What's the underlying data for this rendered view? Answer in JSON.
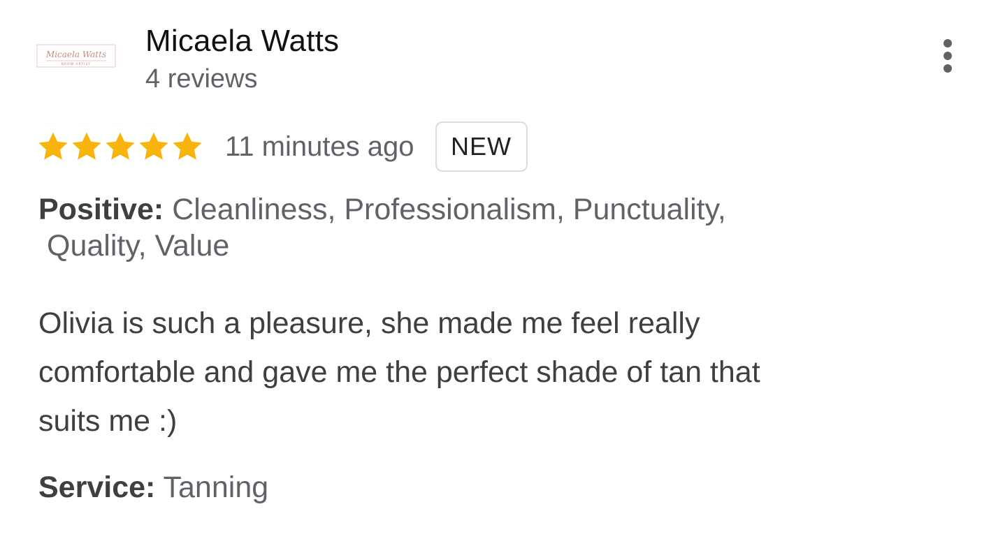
{
  "reviewer": {
    "name": "Micaela Watts",
    "review_count": "4 reviews",
    "avatar_script": "Micaela Watts",
    "avatar_caption": "BROW ARTIST"
  },
  "rating": {
    "stars": 5,
    "max_stars": 5,
    "star_color": "#f9b40b",
    "timestamp": "11 minutes ago",
    "badge": "NEW"
  },
  "positive": {
    "label": "Positive:",
    "line1": "Cleanliness, Professionalism, Punctuality,",
    "line2": "Quality, Value"
  },
  "review_text": {
    "line1": "Olivia is such a pleasure, she made me feel really",
    "line2": "comfortable and gave me the perfect shade of tan that",
    "line3": "suits me :)"
  },
  "service": {
    "label": "Service:",
    "value": "Tanning"
  },
  "icons": {
    "more": "more-vert-icon",
    "star": "star-icon"
  },
  "colors": {
    "accent_star": "#f9b40b",
    "secondary_text": "#5f6368",
    "primary_text": "#202124"
  }
}
